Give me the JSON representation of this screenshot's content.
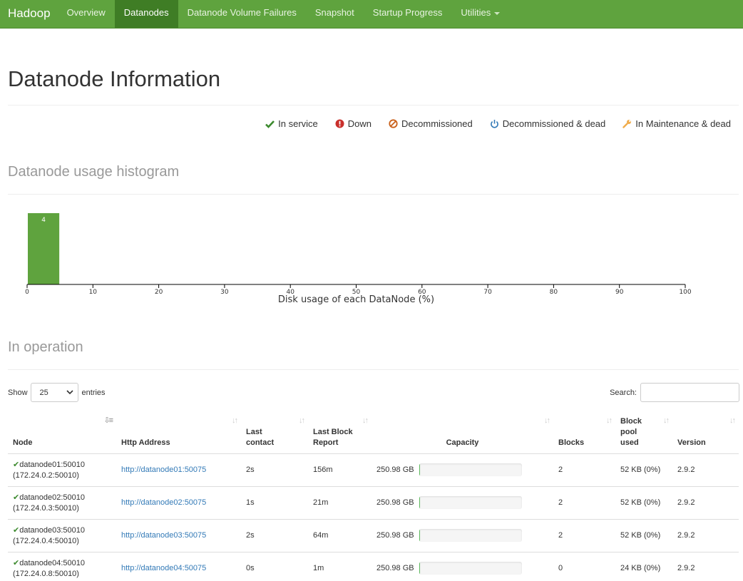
{
  "navbar": {
    "brand": "Hadoop",
    "items": [
      {
        "label": "Overview",
        "active": false
      },
      {
        "label": "Datanodes",
        "active": true
      },
      {
        "label": "Datanode Volume Failures",
        "active": false
      },
      {
        "label": "Snapshot",
        "active": false
      },
      {
        "label": "Startup Progress",
        "active": false
      },
      {
        "label": "Utilities",
        "active": false,
        "dropdown": true
      }
    ]
  },
  "page": {
    "title": "Datanode Information"
  },
  "legend": [
    {
      "label": "In service",
      "icon": "check-icon",
      "color": "#3c8a2e"
    },
    {
      "label": "Down",
      "icon": "exclamation-circle-icon",
      "color": "#c9302c"
    },
    {
      "label": "Decommissioned",
      "icon": "ban-icon",
      "color": "#c9601a"
    },
    {
      "label": "Decommissioned & dead",
      "icon": "power-icon",
      "color": "#337ab7"
    },
    {
      "label": "In Maintenance & dead",
      "icon": "wrench-icon",
      "color": "#f0ad4e"
    }
  ],
  "histogram": {
    "title": "Datanode usage histogram",
    "chart_data": {
      "type": "bar",
      "bins": [
        0,
        5,
        10,
        15,
        20,
        25,
        30,
        35,
        40,
        45,
        50,
        55,
        60,
        65,
        70,
        75,
        80,
        85,
        90,
        95,
        100
      ],
      "values": [
        4,
        0,
        0,
        0,
        0,
        0,
        0,
        0,
        0,
        0,
        0,
        0,
        0,
        0,
        0,
        0,
        0,
        0,
        0,
        0
      ],
      "xticks": [
        "0",
        "10",
        "20",
        "30",
        "40",
        "50",
        "60",
        "70",
        "80",
        "90",
        "100"
      ],
      "xlim": [
        0,
        100
      ],
      "xlabel": "Disk usage of each DataNode (%)",
      "bar_color": "#5fa33e"
    }
  },
  "operation": {
    "title": "In operation",
    "show_label": "Show",
    "entries_value": "25",
    "entries_label": "entries",
    "search_label": "Search:",
    "search_value": "",
    "columns": [
      {
        "label": "Node",
        "sort_icon": "sort-amount-icon"
      },
      {
        "label": "Http Address",
        "sort_icon": "sort-icon"
      },
      {
        "label": "Last contact",
        "sort_icon": "sort-icon"
      },
      {
        "label": "Last Block Report",
        "sort_icon": "sort-icon"
      },
      {
        "label": "Capacity",
        "sort_icon": "sort-icon"
      },
      {
        "label": "Blocks",
        "sort_icon": "sort-icon"
      },
      {
        "label": "Block pool used",
        "sort_icon": "sort-icon"
      },
      {
        "label": "Version",
        "sort_icon": "sort-icon"
      }
    ],
    "rows": [
      {
        "node": "datanode01:50010",
        "node_ip": "(172.24.0.2:50010)",
        "http": "http://datanode01:50075",
        "last_contact": "2s",
        "last_block_report": "156m",
        "capacity": "250.98 GB",
        "capacity_used_pct": 1,
        "blocks": "2",
        "block_pool_used": "52 KB (0%)",
        "version": "2.9.2"
      },
      {
        "node": "datanode02:50010",
        "node_ip": "(172.24.0.3:50010)",
        "http": "http://datanode02:50075",
        "last_contact": "1s",
        "last_block_report": "21m",
        "capacity": "250.98 GB",
        "capacity_used_pct": 1,
        "blocks": "2",
        "block_pool_used": "52 KB (0%)",
        "version": "2.9.2"
      },
      {
        "node": "datanode03:50010",
        "node_ip": "(172.24.0.4:50010)",
        "http": "http://datanode03:50075",
        "last_contact": "2s",
        "last_block_report": "64m",
        "capacity": "250.98 GB",
        "capacity_used_pct": 1,
        "blocks": "2",
        "block_pool_used": "52 KB (0%)",
        "version": "2.9.2"
      },
      {
        "node": "datanode04:50010",
        "node_ip": "(172.24.0.8:50010)",
        "http": "http://datanode04:50075",
        "last_contact": "0s",
        "last_block_report": "1m",
        "capacity": "250.98 GB",
        "capacity_used_pct": 1,
        "blocks": "0",
        "block_pool_used": "24 KB (0%)",
        "version": "2.9.2"
      }
    ]
  }
}
